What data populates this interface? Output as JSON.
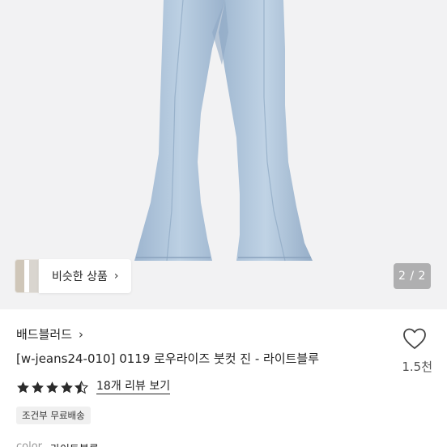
{
  "gallery": {
    "similar_label": "비슷한 상품",
    "page_counter": "2 / 2"
  },
  "product": {
    "brand": "배드블러드",
    "title": "[w-jeans24-010] 0119 로우라이즈 붓컷 진 - 라이트블루",
    "rating": 4.5,
    "reviews_label": "18개 리뷰 보기",
    "shipping_badge": "조건부 무료배송",
    "color_label": "color",
    "color_value": "라이트블루"
  },
  "like": {
    "count": "1.5천"
  },
  "icons": {
    "chevron": "chevron-right-icon",
    "heart": "heart-outline-icon",
    "star": "star-icon"
  },
  "colors": {
    "denim": "#a9c0d8",
    "star": "#2b2b2b"
  }
}
